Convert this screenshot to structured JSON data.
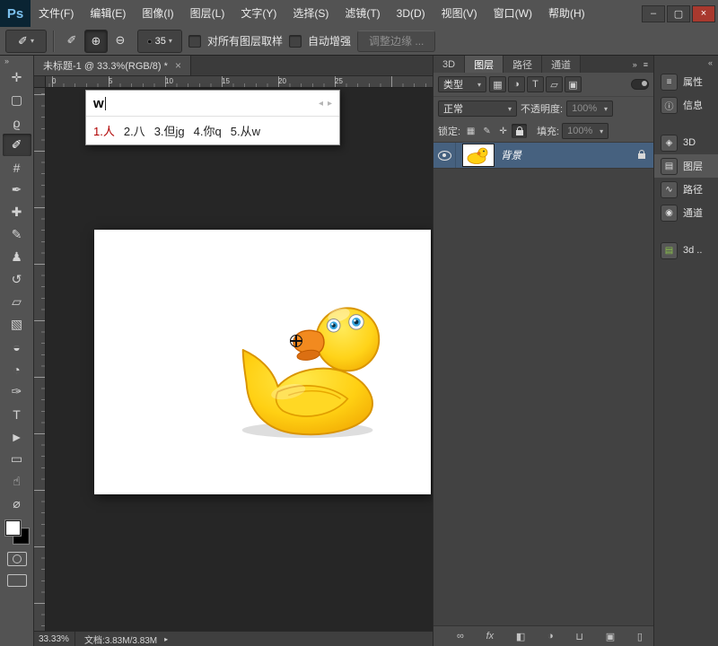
{
  "window": {
    "logo": "Ps",
    "minimize_glyph": "–",
    "maximize_glyph": "▢",
    "close_glyph": "×"
  },
  "menu": {
    "items": [
      "文件(F)",
      "编辑(E)",
      "图像(I)",
      "图层(L)",
      "文字(Y)",
      "选择(S)",
      "滤镜(T)",
      "3D(D)",
      "视图(V)",
      "窗口(W)",
      "帮助(H)"
    ]
  },
  "options_bar": {
    "tool_preset_glyph": "✐",
    "dropdown_glyph": "▾",
    "modes": [
      {
        "name": "new-selection",
        "glyph": "✐",
        "active": false
      },
      {
        "name": "add-to-selection",
        "glyph": "⊕",
        "active": true
      },
      {
        "name": "subtract-from-selection",
        "glyph": "⊖",
        "active": false
      }
    ],
    "brush_dot_glyph": "●",
    "brush_size": "35",
    "sample_all_layers_label": "对所有图层取样",
    "auto_enhance_label": "自动增强",
    "refine_edge_label": "调整边缘 ..."
  },
  "document": {
    "tab_title": "未标题-1 @ 33.3%(RGB/8) *",
    "tab_close_glyph": "×",
    "ruler_marks": [
      "0",
      "5",
      "10",
      "15",
      "20",
      "25"
    ]
  },
  "ime": {
    "input": "w",
    "prev_glyph": "◂",
    "next_glyph": "▸",
    "candidates": [
      "1.人",
      "2.八",
      "3.但jg",
      "4.你q",
      "5.从w"
    ],
    "active_index": 0,
    "active_color": "#b00000"
  },
  "toolbar": {
    "collapse_glyph": "»",
    "active_tool": "quick-selection",
    "tools": [
      {
        "name": "move",
        "glyph": "✛"
      },
      {
        "name": "rectangular-marquee",
        "glyph": "▢"
      },
      {
        "name": "lasso",
        "glyph": "ϱ"
      },
      {
        "name": "quick-selection",
        "glyph": "✐"
      },
      {
        "name": "crop",
        "glyph": "#"
      },
      {
        "name": "eyedropper",
        "glyph": "✒"
      },
      {
        "name": "spot-healing-brush",
        "glyph": "✚"
      },
      {
        "name": "brush",
        "glyph": "✎"
      },
      {
        "name": "clone-stamp",
        "glyph": "♟"
      },
      {
        "name": "history-brush",
        "glyph": "↺"
      },
      {
        "name": "eraser",
        "glyph": "▱"
      },
      {
        "name": "gradient",
        "glyph": "▧"
      },
      {
        "name": "blur",
        "glyph": "◒"
      },
      {
        "name": "dodge",
        "glyph": "◔"
      },
      {
        "name": "pen",
        "glyph": "✑"
      },
      {
        "name": "type",
        "glyph": "T"
      },
      {
        "name": "path-selection",
        "glyph": "►"
      },
      {
        "name": "shape",
        "glyph": "▭"
      },
      {
        "name": "hand",
        "glyph": "☝"
      },
      {
        "name": "zoom",
        "glyph": "⌀"
      }
    ]
  },
  "layers_panel": {
    "tabs": [
      "3D",
      "图层",
      "路径",
      "通道"
    ],
    "active_tab_index": 1,
    "collapse_glyph": "»",
    "menu_glyph": "≡",
    "dropdown_glyph": "▾",
    "filter_label": "类型",
    "filter_icons": [
      {
        "name": "filter-pixel-layers-icon",
        "glyph": "▦"
      },
      {
        "name": "filter-adjustment-layers-icon",
        "glyph": "◑"
      },
      {
        "name": "filter-type-layers-icon",
        "glyph": "T"
      },
      {
        "name": "filter-shape-layers-icon",
        "glyph": "▱"
      },
      {
        "name": "filter-smart-objects-icon",
        "glyph": "▣"
      }
    ],
    "blend_mode": "正常",
    "opacity_label": "不透明度:",
    "opacity_value": "100%",
    "lock_label": "锁定:",
    "lock_icons": [
      {
        "name": "lock-transparent-pixels-icon",
        "glyph": "▦"
      },
      {
        "name": "lock-image-pixels-icon",
        "glyph": "✎"
      },
      {
        "name": "lock-position-icon",
        "glyph": "✛"
      }
    ],
    "fill_label": "填充:",
    "fill_value": "100%",
    "layers": [
      {
        "name": "背景",
        "locked": true,
        "visible": true
      }
    ],
    "bottom_icons": [
      {
        "name": "link-layers-icon",
        "glyph": "∞"
      },
      {
        "name": "layer-style-icon",
        "glyph": "fx"
      },
      {
        "name": "add-layer-mask-icon",
        "glyph": "◧"
      },
      {
        "name": "adjustment-layer-icon",
        "glyph": "◑"
      },
      {
        "name": "new-group-icon",
        "glyph": "⊔"
      },
      {
        "name": "new-layer-icon",
        "glyph": "▣"
      },
      {
        "name": "delete-layer-icon",
        "glyph": "▯"
      }
    ]
  },
  "right_strip": {
    "expand_glyph": "«",
    "items": [
      {
        "name": "properties",
        "label": "属性",
        "glyph": "≡",
        "group": 1,
        "active": false
      },
      {
        "name": "info",
        "label": "信息",
        "glyph": "ⓘ",
        "group": 1,
        "active": false
      },
      {
        "name": "3d",
        "label": "3D",
        "glyph": "◈",
        "group": 2,
        "active": false
      },
      {
        "name": "layers",
        "label": "图层",
        "glyph": "▤",
        "group": 2,
        "active": true
      },
      {
        "name": "paths",
        "label": "路径",
        "glyph": "∿",
        "group": 2,
        "active": false
      },
      {
        "name": "channels",
        "label": "通道",
        "glyph": "◉",
        "group": 2,
        "active": false
      },
      {
        "name": "3d-scene",
        "label": "3d ..",
        "glyph": "▤",
        "group": 3,
        "active": false,
        "color": "#8bc34a"
      }
    ]
  },
  "status_bar": {
    "zoom": "33.33%",
    "doc_info": "文档:3.83M/3.83M",
    "arrow_glyph": "▸"
  },
  "colors": {
    "selected_layer_row": "#46617f",
    "ps_logo_text": "#7cc1ef",
    "close_button": "#a8392e",
    "canvas_surround": "#262626"
  }
}
